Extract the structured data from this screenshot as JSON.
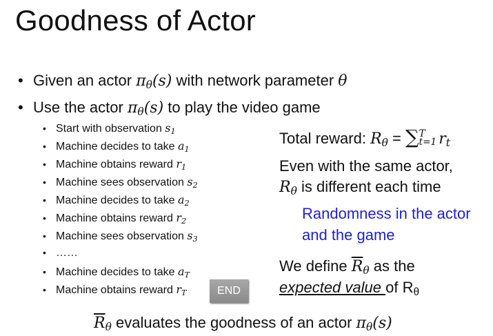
{
  "title": "Goodness of Actor",
  "bullets": [
    {
      "pre": "Given an actor ",
      "math": "π",
      "sub": "θ",
      "math_after": "(s)",
      "post": " with network parameter ",
      "tail": "θ"
    },
    {
      "pre": "Use the actor ",
      "math": "π",
      "sub": "θ",
      "math_after": "(s)",
      "post": " to play the video game"
    }
  ],
  "steps": [
    {
      "text": "Start with observation ",
      "var": "s",
      "sub": "1"
    },
    {
      "text": "Machine decides to take ",
      "var": "a",
      "sub": "1"
    },
    {
      "text": "Machine obtains reward ",
      "var": "r",
      "sub": "1"
    },
    {
      "text": "Machine sees observation ",
      "var": "s",
      "sub": "2"
    },
    {
      "text": "Machine decides to take ",
      "var": "a",
      "sub": "2"
    },
    {
      "text": "Machine obtains reward ",
      "var": "r",
      "sub": "2"
    },
    {
      "text": "Machine sees observation ",
      "var": "s",
      "sub": "3"
    },
    {
      "text": "……",
      "var": "",
      "sub": ""
    },
    {
      "text": "Machine decides to take ",
      "var": "a",
      "sub": "T"
    },
    {
      "text": "Machine obtains reward ",
      "var": "r",
      "sub": "T"
    }
  ],
  "end_badge": "END",
  "total_reward": {
    "label": "Total reward: ",
    "R": "R",
    "R_sub": "θ",
    "eq": " = ",
    "sigma": "∑",
    "sigma_sup": "T",
    "sigma_sub": "t=1",
    "term": "r",
    "term_sub": "t"
  },
  "variance": {
    "line1": "Even with the same actor,",
    "R": "R",
    "R_sub": "θ",
    "line2": " is different each time"
  },
  "randomness": {
    "line1": "Randomness in the actor",
    "line2": "and the game"
  },
  "define": {
    "pre": "We define ",
    "R": "R",
    "R_sub": "θ",
    "post": " as the",
    "expected": "expected value ",
    "of": "of R",
    "of_sub": "θ"
  },
  "footer": {
    "R": "R",
    "R_sub": "θ",
    "text": " evaluates the goodness of an actor ",
    "pi": "π",
    "pi_sub": "θ",
    "pi_after": "(s)"
  }
}
